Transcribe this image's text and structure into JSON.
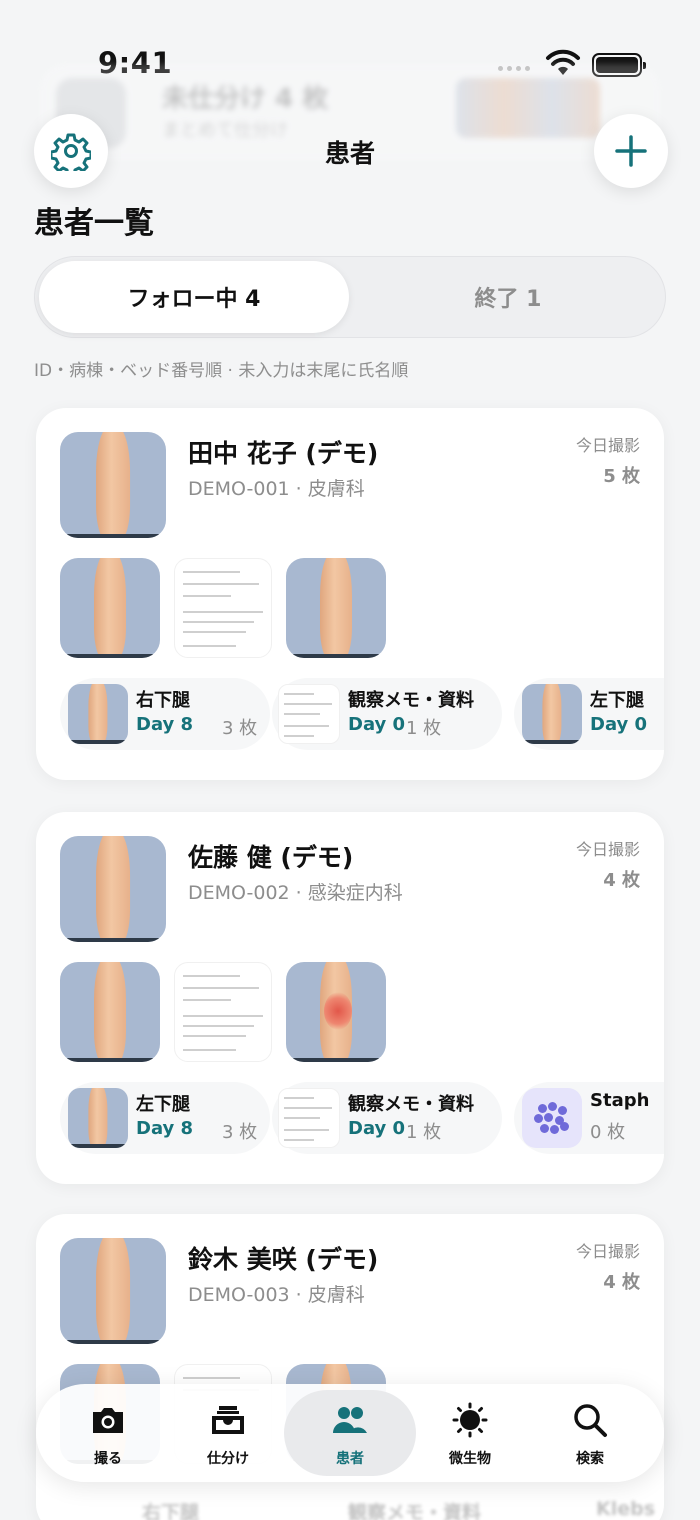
{
  "status_bar": {
    "time": "9:41"
  },
  "ghost_banner": {
    "title": "未仕分け 4 枚",
    "subtitle": "まとめて仕分け"
  },
  "nav": {
    "title": "患者"
  },
  "list_title": "患者一覧",
  "segments": {
    "active": "フォロー中 4",
    "inactive": "終了 1"
  },
  "sort_note": "ID・病棟・ベッド番号順 · 未入力は末尾に氏名順",
  "patients": [
    {
      "name": "田中 花子 (デモ)",
      "id_dept": "DEMO-001 · 皮膚科",
      "today_label": "今日撮影",
      "today_count": "5 枚",
      "chips": [
        {
          "title": "右下腿",
          "day": "Day 8",
          "count": "3 枚"
        },
        {
          "title": "観察メモ・資料",
          "day": "Day 0",
          "count": "1 枚"
        },
        {
          "title": "左下腿",
          "day": "Day 0",
          "count": ""
        }
      ]
    },
    {
      "name": "佐藤 健 (デモ)",
      "id_dept": "DEMO-002 · 感染症内科",
      "today_label": "今日撮影",
      "today_count": "4 枚",
      "chips": [
        {
          "title": "左下腿",
          "day": "Day 8",
          "count": "3 枚"
        },
        {
          "title": "観察メモ・資料",
          "day": "Day 0",
          "count": "1 枚"
        },
        {
          "title": "Staph",
          "day": "",
          "count": "0 枚"
        }
      ]
    },
    {
      "name": "鈴木 美咲 (デモ)",
      "id_dept": "DEMO-003 · 皮膚科",
      "today_label": "今日撮影",
      "today_count": "4 枚"
    }
  ],
  "ghost_bottom": {
    "a": "右下腿",
    "b": "観察メモ・資料",
    "c": "Klebs"
  },
  "tabs": [
    {
      "label": "撮る",
      "icon": "camera-icon"
    },
    {
      "label": "仕分け",
      "icon": "inbox-tray-icon"
    },
    {
      "label": "患者",
      "icon": "people-icon"
    },
    {
      "label": "微生物",
      "icon": "microbe-icon"
    },
    {
      "label": "検索",
      "icon": "search-icon"
    }
  ],
  "colors": {
    "accent": "#16727a",
    "background": "#f4f5f6",
    "card": "#ffffff",
    "thumb_bg": "#a8b8d0"
  }
}
